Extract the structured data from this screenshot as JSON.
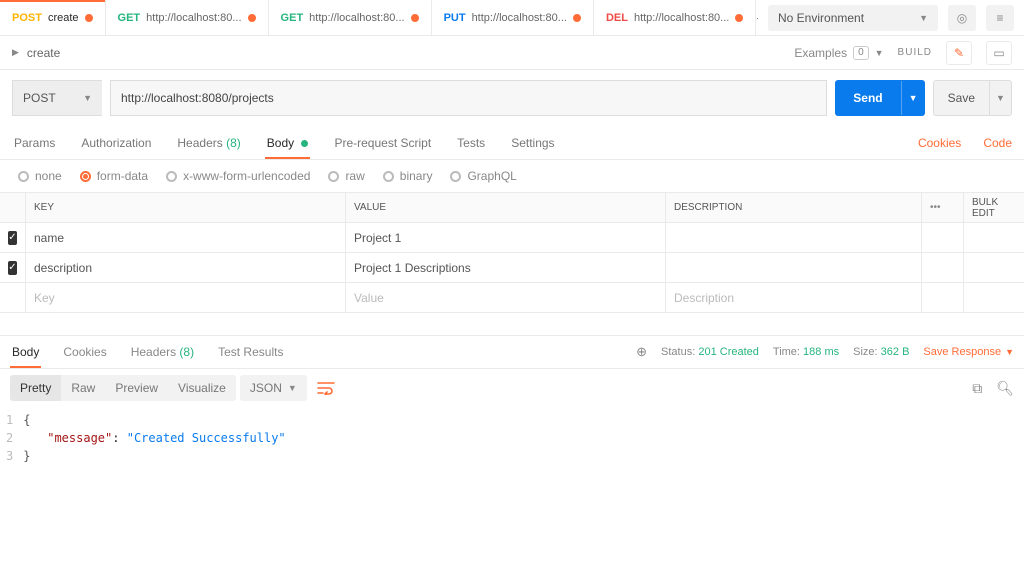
{
  "topbar": {
    "tabs": [
      {
        "method": "POST",
        "mclass": "m-post",
        "label": "create"
      },
      {
        "method": "GET",
        "mclass": "m-get",
        "label": "http://localhost:80..."
      },
      {
        "method": "GET",
        "mclass": "m-get",
        "label": "http://localhost:80..."
      },
      {
        "method": "PUT",
        "mclass": "m-put",
        "label": "http://localhost:80..."
      },
      {
        "method": "DEL",
        "mclass": "m-del",
        "label": "http://localhost:80..."
      }
    ],
    "plus": "+",
    "more": "•••",
    "env": "No Environment"
  },
  "crumb": {
    "name": "create",
    "examples_label": "Examples",
    "examples_count": "0",
    "build": "BUILD"
  },
  "urlbar": {
    "method": "POST",
    "url": "http://localhost:8080/projects",
    "send": "Send",
    "save": "Save"
  },
  "subtabs": {
    "params": "Params",
    "auth": "Authorization",
    "headers": "Headers",
    "headers_count": "(8)",
    "body": "Body",
    "prs": "Pre-request Script",
    "tests": "Tests",
    "settings": "Settings",
    "cookies": "Cookies",
    "code": "Code"
  },
  "body_types": {
    "none": "none",
    "formdata": "form-data",
    "xwww": "x-www-form-urlencoded",
    "raw": "raw",
    "binary": "binary",
    "graphql": "GraphQL"
  },
  "fd": {
    "cols": {
      "key": "Key",
      "value": "Value",
      "desc": "Description",
      "bulk": "Bulk Edit"
    },
    "rows": [
      {
        "key": "name",
        "value": "Project 1",
        "desc": ""
      },
      {
        "key": "description",
        "value": "Project 1 Descriptions",
        "desc": ""
      }
    ],
    "placeholders": {
      "key": "Key",
      "value": "Value",
      "desc": "Description"
    }
  },
  "response": {
    "tabs": {
      "body": "Body",
      "cookies": "Cookies",
      "headers": "Headers",
      "headers_count": "(8)",
      "tests": "Test Results"
    },
    "status_label": "Status:",
    "status": "201 Created",
    "time_label": "Time:",
    "time": "188 ms",
    "size_label": "Size:",
    "size": "362 B",
    "save": "Save Response"
  },
  "resp_toolbar": {
    "pretty": "Pretty",
    "raw": "Raw",
    "preview": "Preview",
    "visualize": "Visualize",
    "format": "JSON"
  },
  "json_body": {
    "l1": "{",
    "l2a": "\"message\"",
    "l2b": ": ",
    "l2c": "\"Created Successfully\"",
    "l3": "}",
    "n1": "1",
    "n2": "2",
    "n3": "3"
  }
}
